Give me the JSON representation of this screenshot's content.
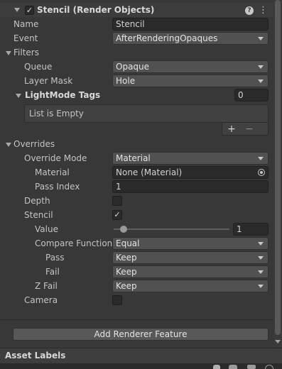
{
  "header": {
    "title": "Stencil (Render Objects)",
    "enabled": true,
    "help_glyph": "?",
    "menu_glyph": "⋮"
  },
  "props": {
    "name_label": "Name",
    "name_value": "Stencil",
    "event_label": "Event",
    "event_value": "AfterRenderingOpaques"
  },
  "filters": {
    "label": "Filters",
    "queue_label": "Queue",
    "queue_value": "Opaque",
    "layer_mask_label": "Layer Mask",
    "layer_mask_value": "Hole",
    "lightmode_label": "LightMode Tags",
    "lightmode_count": "0",
    "empty_text": "List is Empty",
    "add_glyph": "+",
    "remove_glyph": "−"
  },
  "overrides": {
    "label": "Overrides",
    "override_mode_label": "Override Mode",
    "override_mode_value": "Material",
    "material_label": "Material",
    "material_value": "None (Material)",
    "pass_index_label": "Pass Index",
    "pass_index_value": "1",
    "depth_label": "Depth",
    "depth_checked": false,
    "stencil_label": "Stencil",
    "stencil_checked": true,
    "value_label": "Value",
    "value_value": "1",
    "value_slider_fraction": 0.06,
    "compare_label": "Compare Function",
    "compare_value": "Equal",
    "pass_label": "Pass",
    "pass_value": "Keep",
    "fail_label": "Fail",
    "fail_value": "Keep",
    "zfail_label": "Z Fail",
    "zfail_value": "Keep",
    "camera_label": "Camera",
    "camera_checked": false
  },
  "add_renderer_feature": "Add Renderer Feature",
  "asset_labels": "Asset Labels",
  "colors": {
    "background": "#383838",
    "field": "#2a2a2a",
    "dropdown": "#515151",
    "panel": "#3e3e3e"
  },
  "icons": [
    "checkbox-icon",
    "help-icon",
    "menu-icon",
    "object-picker-icon",
    "dropdown-arrow-icon",
    "foldout-arrow-icon"
  ]
}
